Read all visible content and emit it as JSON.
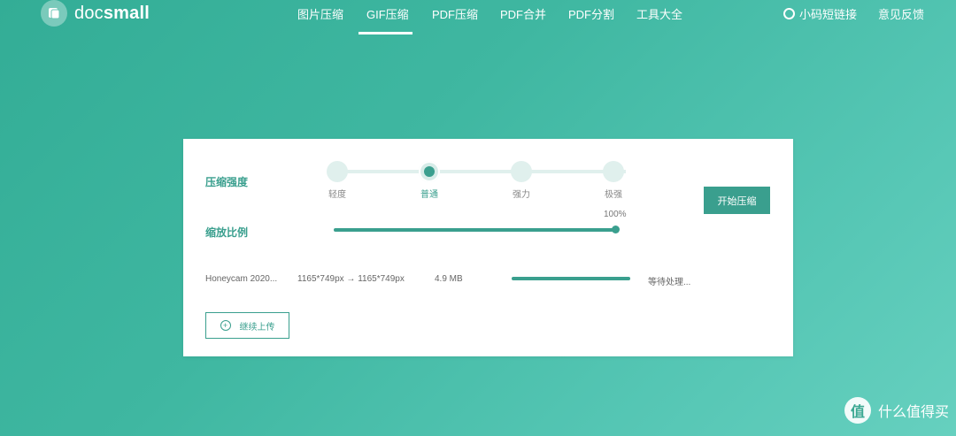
{
  "logo": {
    "text_a": "doc",
    "text_b": "small"
  },
  "nav": {
    "items": [
      {
        "label": "图片压缩"
      },
      {
        "label": "GIF压缩",
        "active": true
      },
      {
        "label": "PDF压缩"
      },
      {
        "label": "PDF合并"
      },
      {
        "label": "PDF分割"
      },
      {
        "label": "工具大全"
      }
    ],
    "short_link": "小码短链接",
    "feedback": "意见反馈"
  },
  "compress": {
    "strength_label": "压缩强度",
    "levels": [
      "轻度",
      "普通",
      "强力",
      "极强"
    ],
    "selected_level": "普通",
    "scale_label": "缩放比例",
    "scale_value": "100%",
    "scale_fraction": 1.0,
    "start_button": "开始压缩"
  },
  "file": {
    "name": "Honeycam 2020...",
    "dimensions": "1165*749px → 1165*749px",
    "size": "4.9 MB",
    "progress_fraction": 1.0,
    "status": "等待处理..."
  },
  "upload_button": "继续上传",
  "watermark": {
    "badge": "值",
    "text": "什么值得买"
  },
  "colors": {
    "accent": "#3a9f8e",
    "background": "#3fb7a1"
  }
}
